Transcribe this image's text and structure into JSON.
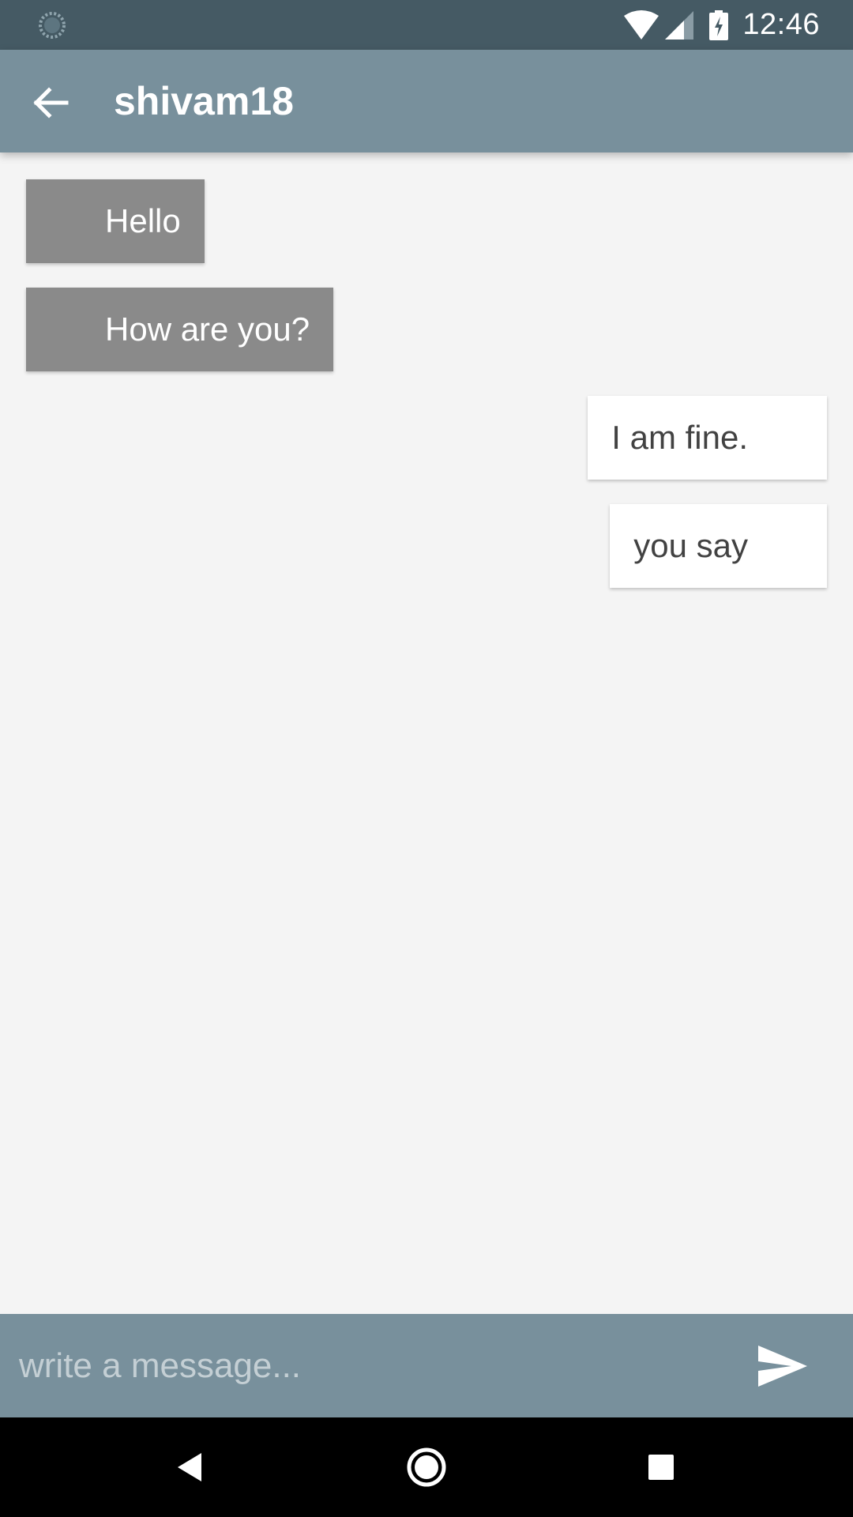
{
  "status_bar": {
    "time": "12:46"
  },
  "header": {
    "title": "shivam18",
    "back_icon": "arrow-back-icon"
  },
  "messages": [
    {
      "text": "Hello",
      "direction": "incoming"
    },
    {
      "text": "How are you?",
      "direction": "incoming"
    },
    {
      "text": "I am fine.",
      "direction": "outgoing"
    },
    {
      "text": "you say",
      "direction": "outgoing"
    }
  ],
  "composer": {
    "placeholder": "write a message...",
    "value": "",
    "send_icon": "send-icon"
  },
  "colors": {
    "status_bar": "#455a64",
    "app_bar": "#78909c",
    "incoming_bubble": "#8a8a8a",
    "outgoing_bubble": "#ffffff",
    "background": "#f4f4f4"
  }
}
